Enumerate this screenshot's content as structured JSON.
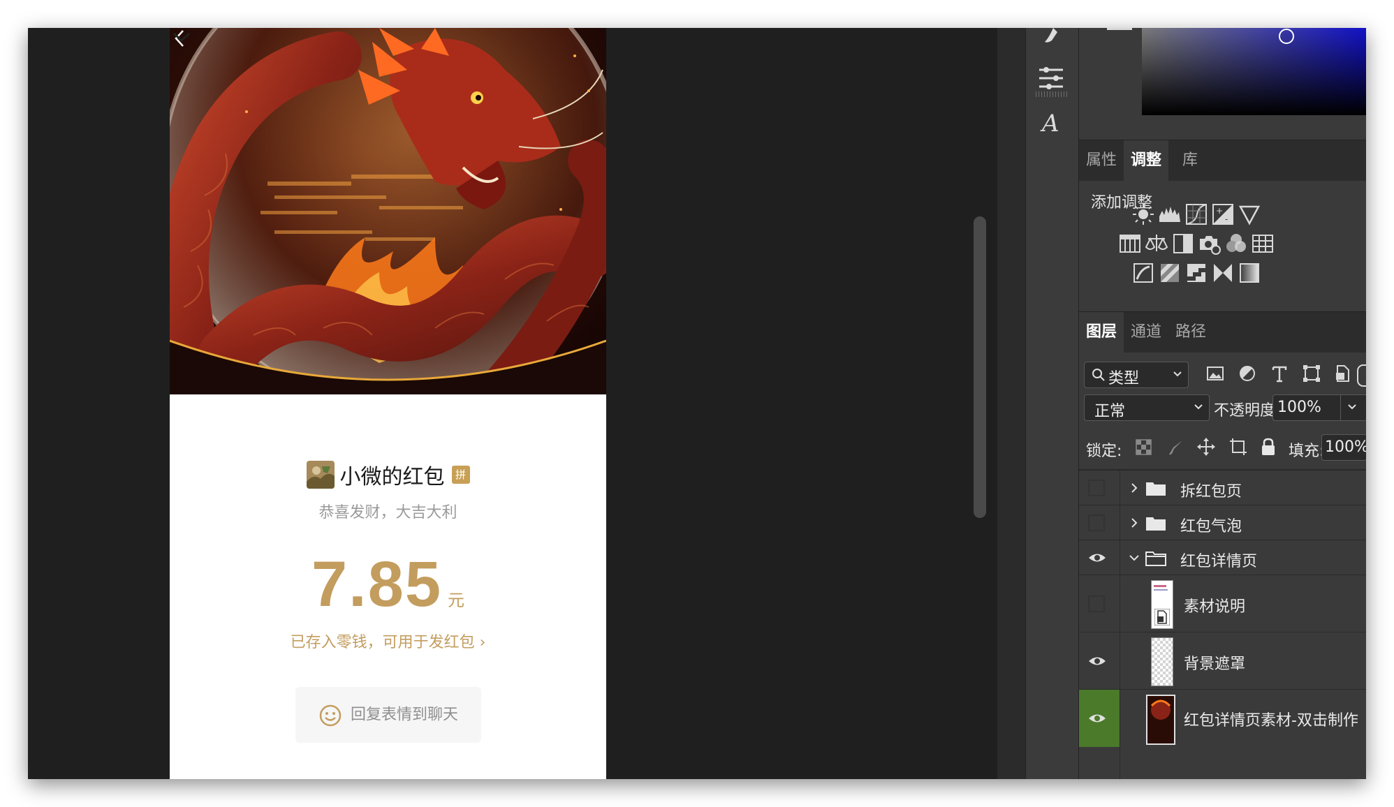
{
  "phone": {
    "sender_name": "小微的红包",
    "sender_badge": "拼",
    "greeting": "恭喜发财，大吉大利",
    "amount": "7.85",
    "amount_unit": "元",
    "stored_text": "已存入零钱，可用于发红包",
    "stored_chevron": "›",
    "reply_button_label": "回复表情到聊天"
  },
  "properties_panel": {
    "tabs": [
      {
        "label": "属性",
        "active": false
      },
      {
        "label": "调整",
        "active": true
      },
      {
        "label": "库",
        "active": false
      }
    ],
    "section_title": "添加调整",
    "adjustment_icons": [
      [
        "brightness-contrast-icon",
        "levels-icon",
        "curves-icon",
        "exposure-icon",
        "vibrance-icon"
      ],
      [
        "hue-saturation-icon",
        "color-balance-icon",
        "black-white-icon",
        "photo-filter-icon",
        "channel-mixer-icon",
        "color-lookup-icon"
      ],
      [
        "invert-icon",
        "posterize-icon",
        "threshold-icon",
        "selective-color-icon",
        "gradient-map-icon"
      ]
    ]
  },
  "layers_panel": {
    "tabs": [
      {
        "label": "图层",
        "active": true
      },
      {
        "label": "通道",
        "active": false
      },
      {
        "label": "路径",
        "active": false
      }
    ],
    "filter_label": "类型",
    "blend_mode": "正常",
    "opacity_label": "不透明度:",
    "opacity_value": "100%",
    "lock_label": "锁定:",
    "fill_label": "填充:",
    "fill_value": "100%",
    "layers": [
      {
        "name": "拆红包页",
        "type": "group",
        "visible": false,
        "expanded": false
      },
      {
        "name": "红包气泡",
        "type": "group",
        "visible": false,
        "expanded": false
      },
      {
        "name": "红包详情页",
        "type": "group",
        "visible": true,
        "expanded": true
      },
      {
        "name": "素材说明",
        "type": "smart-object",
        "visible": false
      },
      {
        "name": "背景遮罩",
        "type": "layer",
        "visible": true
      },
      {
        "name": "红包详情页素材-双击制作",
        "type": "smart-object",
        "visible": true
      }
    ]
  },
  "colors": {
    "gold_accent": "#c39d5e",
    "panel_bg": "#3a3a3a",
    "canvas_bg": "#1f1f1f",
    "visibility_green": "#4a7a2a"
  }
}
